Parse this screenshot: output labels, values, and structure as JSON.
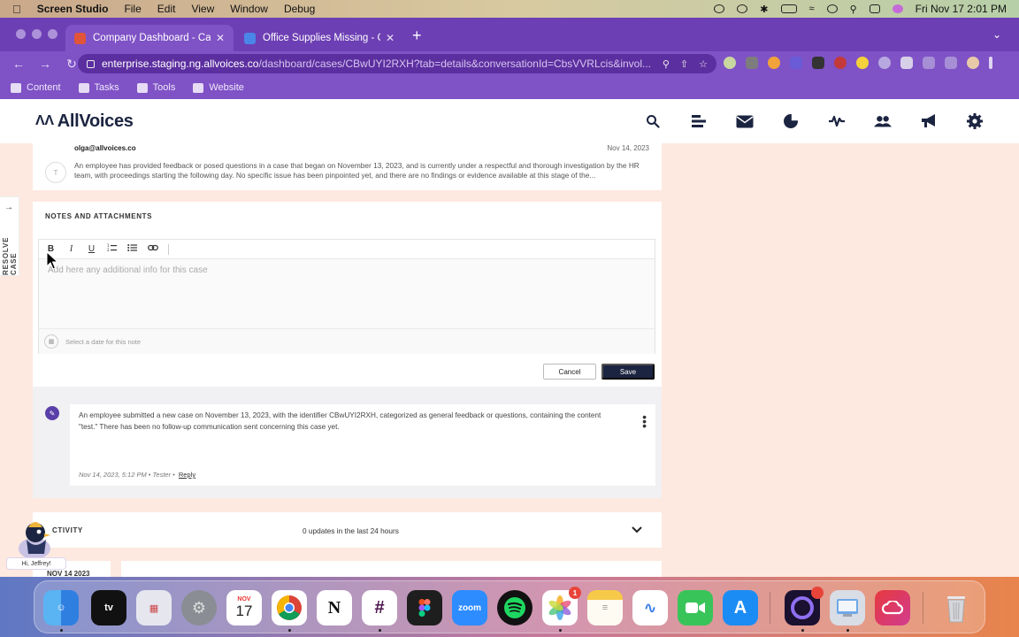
{
  "menubar": {
    "app_name": "Screen Studio",
    "items": [
      "File",
      "Edit",
      "View",
      "Window",
      "Debug"
    ],
    "clock": "Fri Nov 17  2:01 PM"
  },
  "browser": {
    "tabs": [
      {
        "title": "Company Dashboard - Case -",
        "favicon_color": "#e0553a"
      },
      {
        "title": "Office Supplies Missing - Goo",
        "favicon_color": "#4a86e8"
      }
    ],
    "url_host": "enterprise.staging.ng.allvoices.co",
    "url_path": "/dashboard/cases/CBwUYI2RXH?tab=details&conversationId=CbsVVRLcis&invol...",
    "bookmarks": [
      "Content",
      "Tasks",
      "Tools",
      "Website"
    ]
  },
  "app": {
    "brand": "AllVoices",
    "side_tab": "RESOLVE CASE"
  },
  "summary": {
    "email": "olga@allvoices.co",
    "date": "Nov 14, 2023",
    "avatar": "T",
    "text": "An employee has provided feedback or posed questions in a case that began on November 13, 2023, and is currently under a respectful and thorough investigation by the HR team, with proceedings starting the following day. No specific issue has been pinpointed yet, and there are no findings or evidence available at this stage of the..."
  },
  "notes": {
    "title": "NOTES AND ATTACHMENTS",
    "toolbar": {
      "bold": "B",
      "italic": "I",
      "underline": "U"
    },
    "placeholder": "Add here any additional info for this case",
    "date_placeholder": "Select a date for this note",
    "cancel_label": "Cancel",
    "save_label": "Save"
  },
  "note_entry": {
    "text": "An employee submitted a new case on November 13, 2023, with the identifier CBwUYI2RXH, categorized as general feedback or questions, containing the content \"test.\" There has been no follow-up communication sent concerning this case yet.",
    "meta": "Nov 14, 2023, 5:12 PM  •  Tester  •",
    "reply_label": "Reply"
  },
  "activity": {
    "title": "CTIVITY",
    "count_text": "0 updates in the last 24 hours",
    "first_date": "NOV 14 2023"
  },
  "mascot_greeting": "Hi, Jeffrey!",
  "dock": {
    "calendar_month": "NOV",
    "calendar_day": "17",
    "photos_badge": "1",
    "zoom_label": "zoom",
    "tv_label": "tv"
  }
}
